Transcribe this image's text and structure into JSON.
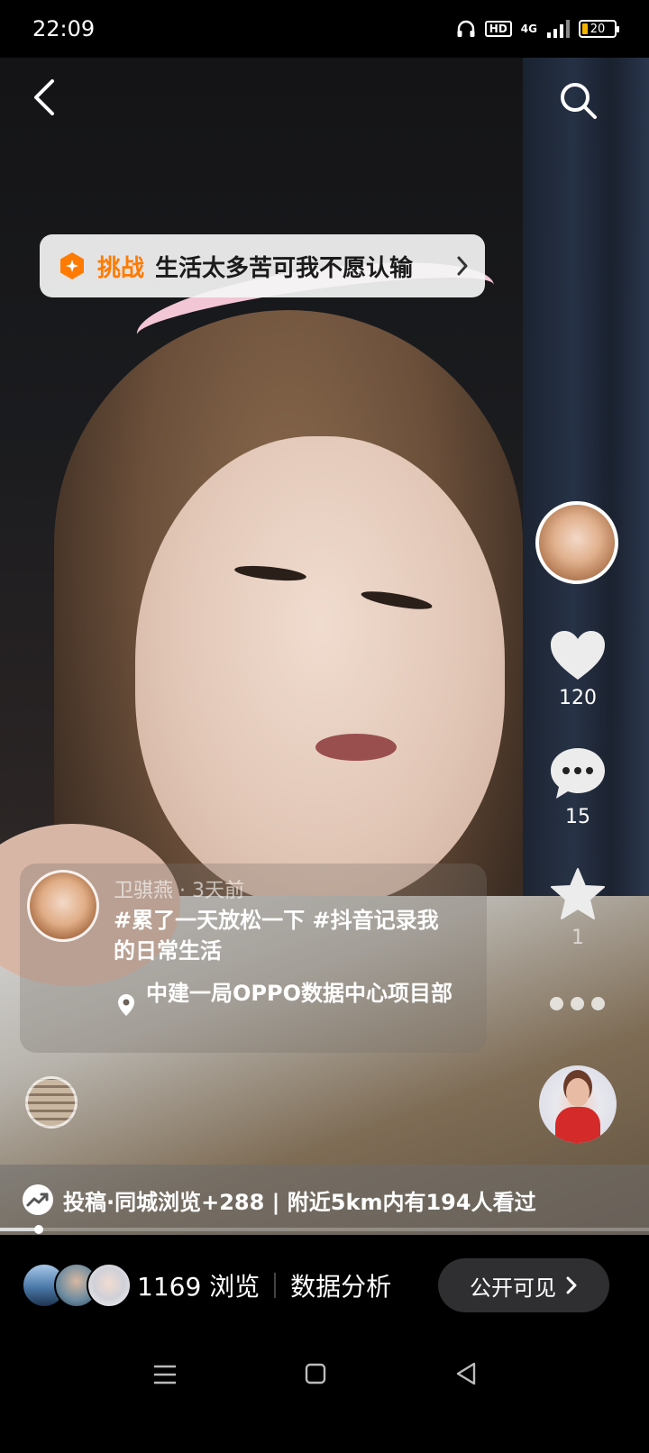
{
  "status_bar": {
    "time": "22:09",
    "hd": "HD",
    "network": "4G",
    "battery": "20"
  },
  "challenge": {
    "tag": "挑战",
    "text": "生活太多苦可我不愿认输"
  },
  "rail": {
    "like_count": "120",
    "comment_count": "15",
    "favorite_count": "1"
  },
  "post": {
    "author": "卫骐燕",
    "time_ago": "3天前",
    "author_line": "卫骐燕 · 3天前",
    "caption": "#累了一天放松一下 #抖音记录我的日常生活",
    "location": "中建一局OPPO数据中心项目部"
  },
  "stats": {
    "text": "投稿·同城浏览+288 | 附近5km内有194人看过"
  },
  "playback": {
    "progress_fraction": 0.06
  },
  "bottom": {
    "views": "1169 浏览",
    "analytics": "数据分析",
    "visibility": "公开可见"
  },
  "colors": {
    "accent_orange": "#ff7a00",
    "battery_low": "#f5b400"
  }
}
